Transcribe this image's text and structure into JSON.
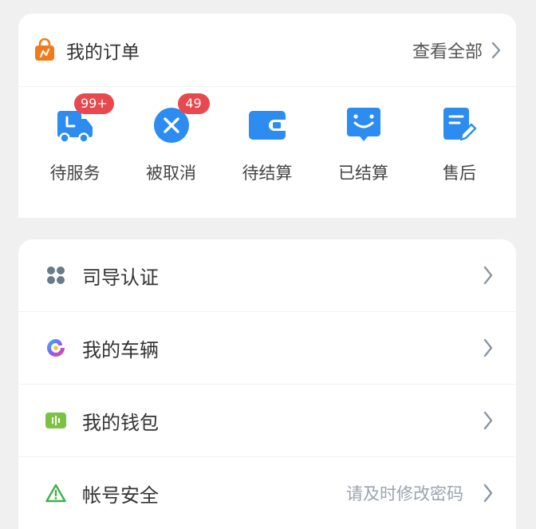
{
  "orders": {
    "title": "我的订单",
    "view_all": "查看全部",
    "statuses": [
      {
        "label": "待服务",
        "badge": "99+",
        "icon": "truck-icon"
      },
      {
        "label": "被取消",
        "badge": "49",
        "icon": "cancel-circle-icon"
      },
      {
        "label": "待结算",
        "badge": "",
        "icon": "wallet-icon"
      },
      {
        "label": "已结算",
        "badge": "",
        "icon": "smile-message-icon"
      },
      {
        "label": "售后",
        "badge": "",
        "icon": "edit-document-icon"
      }
    ]
  },
  "menu": {
    "items": [
      {
        "label": "司导认证",
        "hint": "",
        "icon": "grid-dots-icon"
      },
      {
        "label": "我的车辆",
        "hint": "",
        "icon": "colorful-swirl-icon"
      },
      {
        "label": "我的钱包",
        "hint": "",
        "icon": "wallet-green-icon"
      },
      {
        "label": "帐号安全",
        "hint": "请及时修改密码",
        "icon": "warning-triangle-icon"
      }
    ]
  },
  "colors": {
    "primary_blue": "#2c8cf0",
    "badge_red": "#e8494f",
    "bag_orange": "#f27a1a",
    "wallet_green": "#7cc242",
    "warning_green": "#3fb04a",
    "chevron_gray": "#8a96a3"
  }
}
